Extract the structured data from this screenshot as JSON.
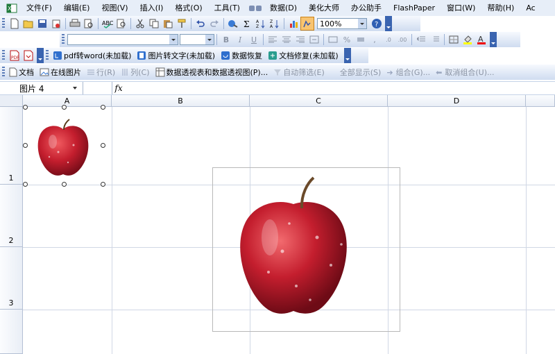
{
  "menubar": {
    "items": [
      "文件(F)",
      "编辑(E)",
      "视图(V)",
      "插入(I)",
      "格式(O)",
      "工具(T)",
      "数据(D)",
      "美化大师",
      "办公助手",
      "FlashPaper",
      "窗口(W)",
      "帮助(H)",
      "Ac"
    ]
  },
  "toolbar_standard": {
    "zoom": "100%"
  },
  "toolbar_format": {
    "font_name": "",
    "font_size": ""
  },
  "toolbar_plugins": {
    "pdf_to_word": "pdf转word(未加载)",
    "image_to_text": "图片转文字(未加载)",
    "data_recovery": "数据恢复",
    "doc_repair": "文档修复(未加载)"
  },
  "toolbar_office": {
    "doc": "文档",
    "online_picture": "在线图片",
    "row": "行(R)",
    "column": "列(C)",
    "pivot": "数据透视表和数据透视图(P)...",
    "autofilter": "自动筛选(E)",
    "show_all": "全部显示(S)",
    "group": "组合(G)...",
    "ungroup": "取消组合(U)..."
  },
  "formulabar": {
    "name_box": "图片 4",
    "fx": "fx",
    "formula": ""
  },
  "sheet": {
    "columns": [
      "A",
      "B",
      "C",
      "D"
    ],
    "rows": [
      "1",
      "2",
      "3"
    ]
  },
  "colors": {
    "menubar_bg": "#e7eef8",
    "toolbar_end": "#3a64b0",
    "apple_red": "#c41e2e"
  }
}
